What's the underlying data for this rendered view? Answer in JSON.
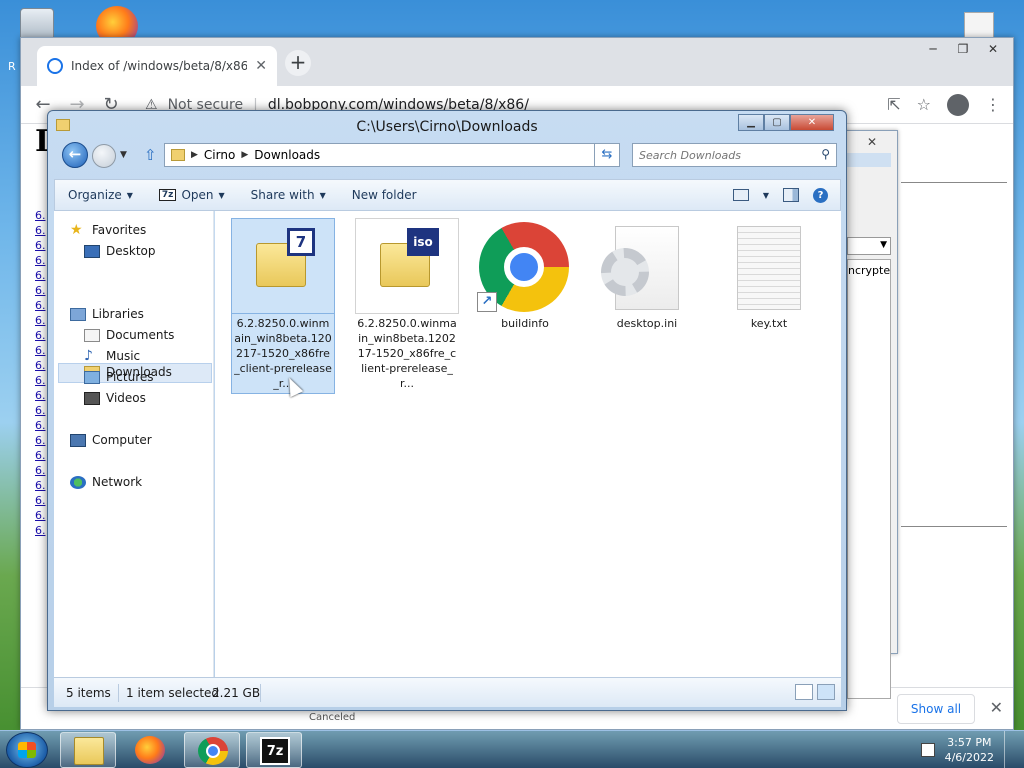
{
  "desktop": {
    "edge_letter": "R"
  },
  "browser": {
    "tab_title": "Index of /windows/beta/8/x86/",
    "security_label": "Not secure",
    "url": "dl.bobpony.com/windows/beta/8/x86/",
    "page_heading_initial": "I",
    "link_prefix": "6.",
    "partial_text": "ncrypte",
    "downloads": {
      "status": "Canceled",
      "show_all": "Show all"
    }
  },
  "explorer": {
    "title": "C:\\Users\\Cirno\\Downloads",
    "breadcrumb": [
      "Cirno",
      "Downloads"
    ],
    "search_placeholder": "Search Downloads",
    "commands": {
      "organize": "Organize",
      "open": "Open",
      "open_icon": "7z",
      "share_with": "Share with",
      "new_folder": "New folder"
    },
    "nav": {
      "favorites": "Favorites",
      "desktop": "Desktop",
      "downloads": "Downloads",
      "libraries": "Libraries",
      "documents": "Documents",
      "music": "Music",
      "pictures": "Pictures",
      "videos": "Videos",
      "computer": "Computer",
      "network": "Network"
    },
    "files": [
      {
        "name": "6.2.8250.0.winmain_win8beta.120217-1520_x86fre_client-prerelease_r...",
        "icon": "7z-archive-icon",
        "badge": "7",
        "selected": true
      },
      {
        "name": "6.2.8250.0.winmain_win8beta.120217-1520_x86fre_client-prerelease_r...",
        "icon": "iso-disc-image-icon",
        "badge": "iso",
        "selected": false
      },
      {
        "name": "buildinfo",
        "icon": "chrome-shortcut-icon"
      },
      {
        "name": "desktop.ini",
        "icon": "config-settings-icon"
      },
      {
        "name": "key.txt",
        "icon": "text-document-icon"
      }
    ],
    "status": {
      "items": "5 items",
      "selected": "1 item selected",
      "size": "2.21 GB"
    }
  },
  "taskbar": {
    "pinned": [
      "windows-explorer",
      "firefox",
      "google-chrome",
      "7-zip"
    ],
    "seven_zip_label": "7z",
    "time": "3:57 PM",
    "date": "4/6/2022"
  },
  "colors": {
    "selection": "#cde3f8",
    "link": "#1a0dab",
    "chrome_accent": "#1a73e8"
  }
}
